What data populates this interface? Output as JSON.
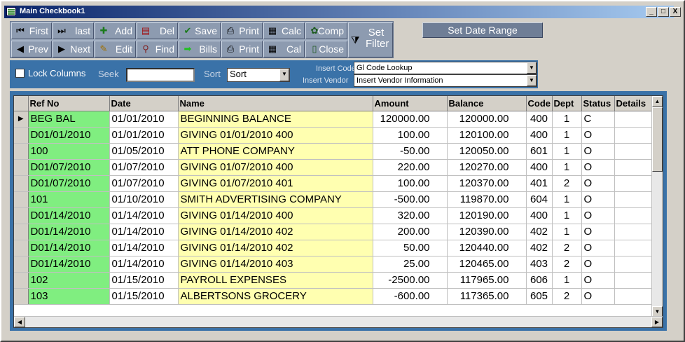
{
  "window": {
    "title": "Main Checkbook1",
    "buttons": {
      "minimize": "_",
      "maximize": "□",
      "close": "X"
    }
  },
  "toolbar": {
    "first": "First",
    "last": "last",
    "add": "Add",
    "del": "Del",
    "save": "Save",
    "print1": "Print",
    "calc": "Calc",
    "comp": "Comp",
    "prev": "Prev",
    "next": "Next",
    "edit": "Edit",
    "find": "Find",
    "bills": "Bills",
    "print2": "Print",
    "cal": "Cal",
    "close": "Close",
    "set_filter": "Set Filter"
  },
  "date_range": "Set Date Range",
  "options": {
    "lock_columns": "Lock Columns",
    "seek_label": "Seek",
    "seek_value": "",
    "sort_label": "Sort",
    "sort_value": "Sort",
    "insert_code_label": "Insert Code",
    "insert_code_value": "Gl Code Lookup",
    "insert_vendor_label": "Insert Vendor",
    "insert_vendor_value": "Insert Vendor Information"
  },
  "grid": {
    "columns": [
      "Ref No",
      "Date",
      "Name",
      "Amount",
      "Balance",
      "Code",
      "Dept",
      "Status",
      "Details"
    ],
    "current_row_marker": "▶",
    "rows": [
      [
        "BEG BAL",
        "01/01/2010",
        "BEGINNING BALANCE",
        "120000.00",
        "120000.00",
        "400",
        "1",
        "C",
        ""
      ],
      [
        "D01/01/2010",
        "01/01/2010",
        "GIVING 01/01/2010 400",
        "100.00",
        "120100.00",
        "400",
        "1",
        "O",
        ""
      ],
      [
        "100",
        "01/05/2010",
        "ATT PHONE COMPANY",
        "-50.00",
        "120050.00",
        "601",
        "1",
        "O",
        ""
      ],
      [
        "D01/07/2010",
        "01/07/2010",
        "GIVING 01/07/2010 400",
        "220.00",
        "120270.00",
        "400",
        "1",
        "O",
        ""
      ],
      [
        "D01/07/2010",
        "01/07/2010",
        "GIVING 01/07/2010 401",
        "100.00",
        "120370.00",
        "401",
        "2",
        "O",
        ""
      ],
      [
        "101",
        "01/10/2010",
        "SMITH ADVERTISING COMPANY",
        "-500.00",
        "119870.00",
        "604",
        "1",
        "O",
        ""
      ],
      [
        "D01/14/2010",
        "01/14/2010",
        "GIVING 01/14/2010 400",
        "320.00",
        "120190.00",
        "400",
        "1",
        "O",
        ""
      ],
      [
        "D01/14/2010",
        "01/14/2010",
        "GIVING 01/14/2010 402",
        "200.00",
        "120390.00",
        "402",
        "1",
        "O",
        ""
      ],
      [
        "D01/14/2010",
        "01/14/2010",
        "GIVING 01/14/2010 402",
        "50.00",
        "120440.00",
        "402",
        "2",
        "O",
        ""
      ],
      [
        "D01/14/2010",
        "01/14/2010",
        "GIVING 01/14/2010 403",
        "25.00",
        "120465.00",
        "403",
        "2",
        "O",
        ""
      ],
      [
        "102",
        "01/15/2010",
        "PAYROLL EXPENSES",
        "-2500.00",
        "117965.00",
        "606",
        "1",
        "O",
        ""
      ],
      [
        "103",
        "01/15/2010",
        "ALBERTSONS GROCERY",
        "-600.00",
        "117365.00",
        "605",
        "2",
        "O",
        ""
      ]
    ]
  },
  "colors": {
    "ref_col": "#80ee80",
    "name_col": "#ffffb0",
    "panel": "#3a72a8",
    "toolbar": "#8d9bb0"
  },
  "icons": [
    "first-icon",
    "last-icon",
    "add-icon",
    "del-icon",
    "save-icon",
    "printer-icon",
    "calculator-icon",
    "comp-icon",
    "prev-icon",
    "next-icon",
    "edit-icon",
    "find-icon",
    "bills-arrow-icon",
    "calendar-icon",
    "close-door-icon",
    "filter-icon"
  ]
}
